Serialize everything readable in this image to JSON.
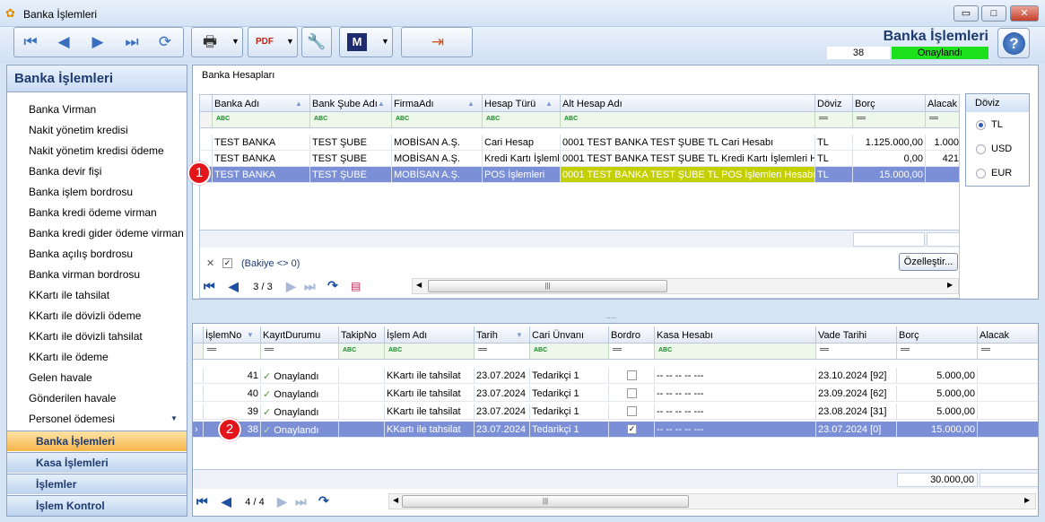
{
  "window": {
    "title": "Banka İşlemleri",
    "min": "▭",
    "max": "□",
    "close": "✕"
  },
  "header": {
    "title": "Banka İşlemleri",
    "record_no": "38",
    "status": "Onaylandı",
    "help": "?"
  },
  "sidebar": {
    "title": "Banka İşlemleri",
    "items": [
      "Banka Virman",
      "Nakit yönetim kredisi",
      "Nakit yönetim kredisi ödeme",
      "Banka devir fişi",
      "Banka işlem bordrosu",
      "Banka kredi ödeme virman",
      "Banka kredi gider ödeme virman",
      "Banka açılış bordrosu",
      "Banka virman bordrosu",
      "KKartı ile tahsilat",
      "KKartı ile dövizli ödeme",
      "KKartı ile dövizli tahsilat",
      "KKartı ile ödeme",
      "Gelen havale",
      "Gönderilen havale",
      "Personel ödemesi"
    ],
    "nav": [
      "Banka İşlemleri",
      "Kasa İşlemleri",
      "İşlemler",
      "İşlem Kontrol"
    ]
  },
  "accounts": {
    "panel_title": "Banka Hesapları",
    "columns": [
      "Banka Adı",
      "Bank Şube Adı",
      "FirmaAdı",
      "Hesap Türü",
      "Alt Hesap Adı",
      "Döviz",
      "Borç",
      "Alacak"
    ],
    "rows": [
      [
        "TEST BANKA",
        "TEST ŞUBE",
        "MOBİSAN A.Ş.",
        "Cari Hesap",
        "0001 TEST BANKA TEST ŞUBE TL Cari Hesabı",
        "TL",
        "1.125.000,00",
        "1.000"
      ],
      [
        "TEST BANKA",
        "TEST ŞUBE",
        "MOBİSAN A.Ş.",
        "Kredi Kartı İşlemle",
        "0001 TEST BANKA TEST ŞUBE TL Kredi Kartı İşlemleri Hesab",
        "TL",
        "0,00",
        "421"
      ],
      [
        "TEST BANKA",
        "TEST ŞUBE",
        "MOBİSAN A.Ş.",
        "POS İşlemleri",
        "0001 TEST BANKA TEST ŞUBE TL POS İşlemleri Hesabı",
        "TL",
        "15.000,00",
        ""
      ]
    ],
    "filter_text": "(Bakiye <> 0)",
    "customize": "Özelleştir...",
    "page": "3 / 3",
    "filter_close": "✕"
  },
  "currency": {
    "title": "Döviz",
    "options": [
      "TL",
      "USD",
      "EUR"
    ],
    "selected": "TL"
  },
  "transactions": {
    "columns": [
      "İşlemNo",
      "KayıtDurumu",
      "TakipNo",
      "İşlem Adı",
      "Tarih",
      "Cari Ünvanı",
      "Bordro",
      "Kasa Hesabı",
      "Vade Tarihi",
      "Borç",
      "Alacak"
    ],
    "rows": [
      [
        "41",
        "Onaylandı",
        "",
        "KKartı ile tahsilat",
        "23.07.2024",
        "Tedarikçi 1",
        "",
        "-- -- -- -- ---",
        "23.10.2024 [92]",
        "5.000,00"
      ],
      [
        "40",
        "Onaylandı",
        "",
        "KKartı ile tahsilat",
        "23.07.2024",
        "Tedarikçi 1",
        "",
        "-- -- -- -- ---",
        "23.09.2024 [62]",
        "5.000,00"
      ],
      [
        "39",
        "Onaylandı",
        "",
        "KKartı ile tahsilat",
        "23.07.2024",
        "Tedarikçi 1",
        "",
        "-- -- -- -- ---",
        "23.08.2024 [31]",
        "5.000,00"
      ],
      [
        "38",
        "Onaylandı",
        "",
        "KKartı ile tahsilat",
        "23.07.2024",
        "Tedarikçi 1",
        "✓",
        "-- -- -- -- ---",
        "23.07.2024 [0]",
        "15.000,00"
      ]
    ],
    "total": "30.000,00",
    "page": "4 / 4"
  },
  "badges": [
    "1",
    "2"
  ],
  "icons": {
    "first": "⏮",
    "prev": "◀",
    "next": "▶",
    "last": "⏭",
    "refresh": "⟳",
    "print": "🖶",
    "pdf": "PDF",
    "tools": "🔧",
    "m": "M",
    "exit": "⇥",
    "check": "✓"
  },
  "colors": {
    "accent": "#1e3b70",
    "selected_row": "#7b8fd6",
    "status_green": "#1ee11e",
    "highlight": "#c4cf00",
    "badge": "#e3141a"
  }
}
